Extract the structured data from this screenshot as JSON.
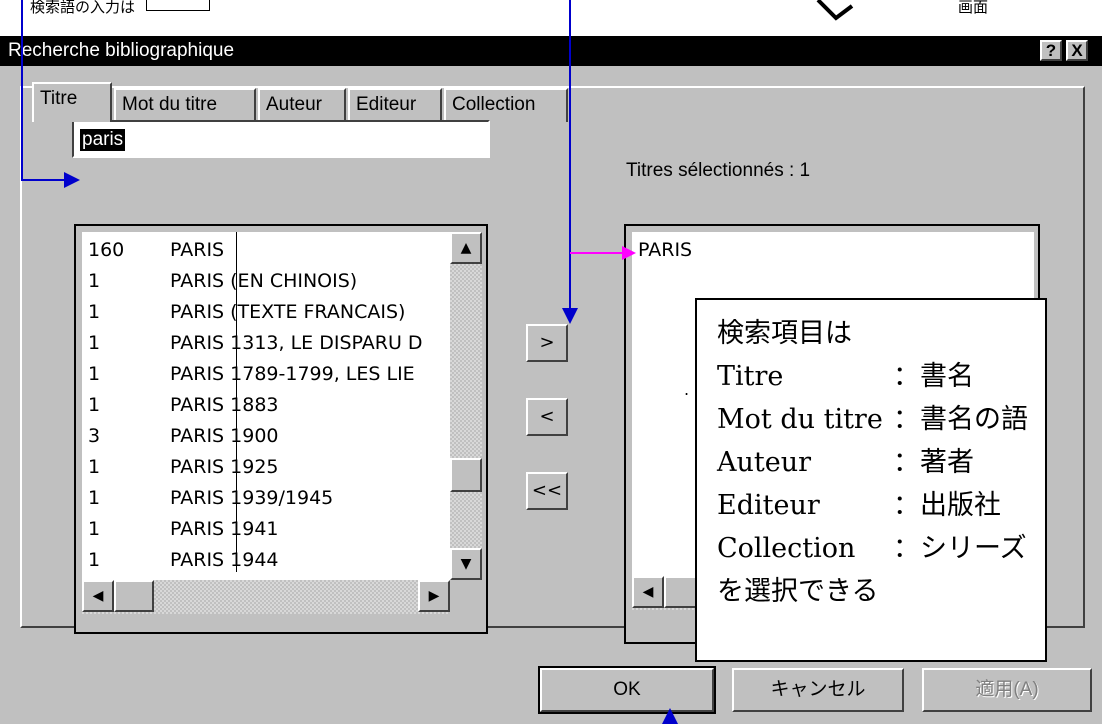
{
  "window": {
    "title": "Recherche bibliographique",
    "help_button": "?",
    "close_button": "X"
  },
  "tabs": [
    {
      "label": "Titre"
    },
    {
      "label": "Mot du titre"
    },
    {
      "label": "Auteur"
    },
    {
      "label": "Editeur"
    },
    {
      "label": "Collection"
    }
  ],
  "search": {
    "value": "paris"
  },
  "selected_count_label": "Titres sélectionnés : 1",
  "results_list": [
    {
      "count": "160",
      "title": "PARIS"
    },
    {
      "count": "1",
      "title": "PARIS (EN CHINOIS)"
    },
    {
      "count": "1",
      "title": "PARIS (TEXTE FRANCAIS)"
    },
    {
      "count": "1",
      "title": "PARIS 1313, LE DISPARU D"
    },
    {
      "count": "1",
      "title": "PARIS 1789-1799, LES LIE"
    },
    {
      "count": "1",
      "title": "PARIS 1883"
    },
    {
      "count": "3",
      "title": "PARIS 1900"
    },
    {
      "count": "1",
      "title": "PARIS 1925"
    },
    {
      "count": "1",
      "title": "PARIS 1939/1945"
    },
    {
      "count": "1",
      "title": "PARIS 1941"
    },
    {
      "count": "1",
      "title": "PARIS 1944"
    }
  ],
  "selected_list": [
    {
      "title": "PARIS"
    }
  ],
  "move_buttons": {
    "add": ">",
    "remove": "<",
    "remove_all": "<<"
  },
  "dialog_buttons": {
    "ok": "OK",
    "cancel": "キャンセル",
    "apply": "適用(A)"
  },
  "annotation": {
    "heading": "検索項目は",
    "items": [
      {
        "key": "Titre",
        "value": "：書名"
      },
      {
        "key": "Mot du titre",
        "value": "：書名の語"
      },
      {
        "key": "Auteur",
        "value": "：著者"
      },
      {
        "key": "Editeur",
        "value": "：出版社"
      },
      {
        "key": "Collection",
        "value": "：シリーズ"
      }
    ],
    "footer": "を選択できる"
  },
  "top_fragments": {
    "left": "検索語の入力は",
    "right": "画面"
  },
  "colors": {
    "annotation_arrow_blue": "#0000cc",
    "annotation_arrow_magenta": "#ff00ff",
    "dialog_face": "#c0c0c0",
    "titlebar": "#000000"
  }
}
